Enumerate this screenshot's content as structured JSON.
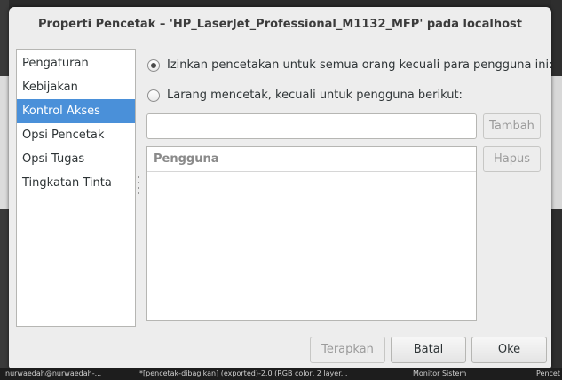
{
  "dialog": {
    "title": "Properti Pencetak – 'HP_LaserJet_Professional_M1132_MFP' pada localhost"
  },
  "sidebar": {
    "items": [
      {
        "label": "Pengaturan",
        "selected": false
      },
      {
        "label": "Kebijakan",
        "selected": false
      },
      {
        "label": "Kontrol Akses",
        "selected": true
      },
      {
        "label": "Opsi Pencetak",
        "selected": false
      },
      {
        "label": "Opsi Tugas",
        "selected": false
      },
      {
        "label": "Tingkatan Tinta",
        "selected": false
      }
    ]
  },
  "access": {
    "allow_all_label": "Izinkan pencetakan untuk semua orang kecuali para pengguna ini:",
    "deny_all_label": "Larang mencetak, kecuali untuk pengguna berikut:",
    "selected_option": "allow_all",
    "user_input_value": "",
    "add_button": "Tambah",
    "remove_button": "Hapus",
    "list_header": "Pengguna",
    "users": []
  },
  "footer": {
    "apply_button": "Terapkan",
    "cancel_button": "Batal",
    "ok_button": "Oke"
  },
  "taskbar": {
    "items": [
      "nurwaedah@nurwaedah-...",
      "*[pencetak-dibagikan] (exported)-2.0 (RGB color, 2 layer...",
      "Monitor Sistem",
      "Pencet"
    ]
  },
  "colors": {
    "selection": "#4a90d9",
    "dialog_bg": "#ededed"
  }
}
